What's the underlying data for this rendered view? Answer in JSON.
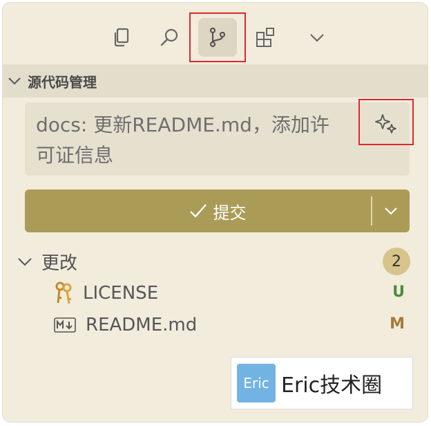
{
  "toolbar": {
    "icons": [
      "copy-icon",
      "search-icon",
      "source-control-icon",
      "extensions-icon",
      "chevron-down-icon"
    ],
    "active": "source-control-icon"
  },
  "section": {
    "title": "源代码管理"
  },
  "commit_message": {
    "value": "docs: 更新README.md，添加许可证信息"
  },
  "commit_button": {
    "label": "提交"
  },
  "changes": {
    "title": "更改",
    "count": "2",
    "files": [
      {
        "name": "LICENSE",
        "status": "U",
        "status_color": "#4c8a3b",
        "icon": "license-key-icon"
      },
      {
        "name": "README.md",
        "status": "M",
        "status_color": "#a57a3a",
        "icon": "markdown-icon"
      }
    ]
  },
  "watermark": {
    "logo_text": "Eric",
    "text": "Eric技术圈"
  },
  "colors": {
    "panel_bg": "#f2ecdd",
    "commit_button": "#aa9b57",
    "badge": "#d6c48a",
    "highlight": "#e0262b"
  }
}
